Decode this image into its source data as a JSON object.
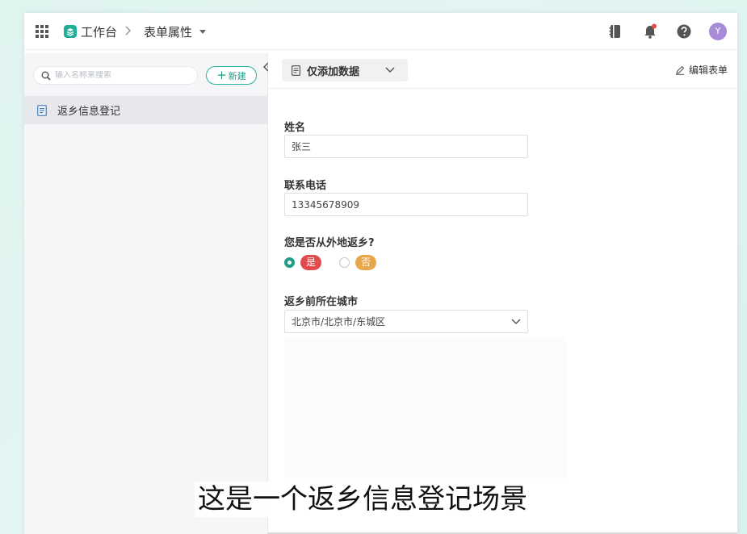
{
  "topbar": {
    "brand": "工作台",
    "breadcrumb": "表单属性"
  },
  "sidebar": {
    "search_placeholder": "输入名称来搜索",
    "new_button": "新建",
    "items": [
      {
        "label": "返乡信息登记"
      }
    ]
  },
  "main": {
    "mode_select": "仅添加数据",
    "edit_form": "编辑表单",
    "fields": {
      "name": {
        "label": "姓名",
        "value": "张三"
      },
      "phone": {
        "label": "联系电话",
        "value": "13345678909"
      },
      "returned": {
        "label": "您是否从外地返乡?",
        "options": [
          {
            "label": "是",
            "color": "#e24b4b",
            "checked": true
          },
          {
            "label": "否",
            "color": "#e8a84a",
            "checked": false
          }
        ]
      },
      "city": {
        "label": "返乡前所在城市",
        "value": "北京市/北京市/东城区"
      }
    }
  },
  "subtitle": "这是一个返乡信息登记场景",
  "colors": {
    "accent": "#1f9d87",
    "notification_dot": "#e24b4b",
    "avatar": "#a78bd8"
  },
  "avatar_initial": "Y",
  "icons": [
    "apps-grid-icon",
    "brand-cube-icon",
    "chevron-right-icon",
    "caret-down-icon",
    "notebook-icon",
    "bell-icon",
    "help-icon",
    "search-icon",
    "double-chevron-left-icon",
    "document-icon",
    "chevron-down-icon",
    "pencil-icon"
  ]
}
